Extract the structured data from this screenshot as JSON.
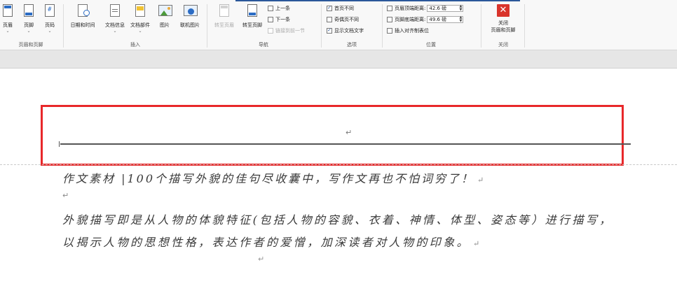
{
  "ribbon": {
    "header_footer": {
      "header": "页眉",
      "footer": "页脚",
      "page_number": "页码",
      "label": "页眉和页脚"
    },
    "insert": {
      "date_time": "日期和时间",
      "doc_info": "文档信息",
      "doc_parts": "文档部件",
      "picture": "图片",
      "online_picture": "联机图片",
      "label": "插入"
    },
    "navigation": {
      "goto_header": "转至页眉",
      "goto_footer": "转至页脚",
      "previous": "上一条",
      "next": "下一条",
      "link_to_previous": "链接到前一节",
      "label": "导航"
    },
    "options": {
      "different_first_page": "首页不同",
      "different_odd_even": "奇偶页不同",
      "show_document_text": "显示文档文字",
      "label": "选项"
    },
    "position": {
      "header_from_top_label": "页眉顶端距离:",
      "header_from_top_value": "42.6 磅",
      "footer_from_bottom_label": "页脚底端距离:",
      "footer_from_bottom_value": "49.6 磅",
      "insert_alignment_tab": "插入对齐制表位",
      "label": "位置"
    },
    "close": {
      "close_label_1": "关闭",
      "close_label_2": "页眉和页脚",
      "label": "关闭"
    }
  },
  "document": {
    "header_return_mark": "↵",
    "line1": "作文素材 |100个描写外貌的佳句尽收囊中，写作文再也不怕词穷了！",
    "empty_mark": "↵",
    "line2": "外貌描写即是从人物的体貌特征(包括人物的容貌、衣着、神情、体型、姿态等）进行描写，",
    "line3": "以揭示人物的思想性格，表达作者的爱憎，加深读者对人物的印象。",
    "return_mark": "↵",
    "tail_mark": "↵"
  },
  "colors": {
    "accent": "#2b579a",
    "highlight_box": "#e8282a",
    "close_button": "#d9342b",
    "link_blue": "#2b6cc4"
  }
}
